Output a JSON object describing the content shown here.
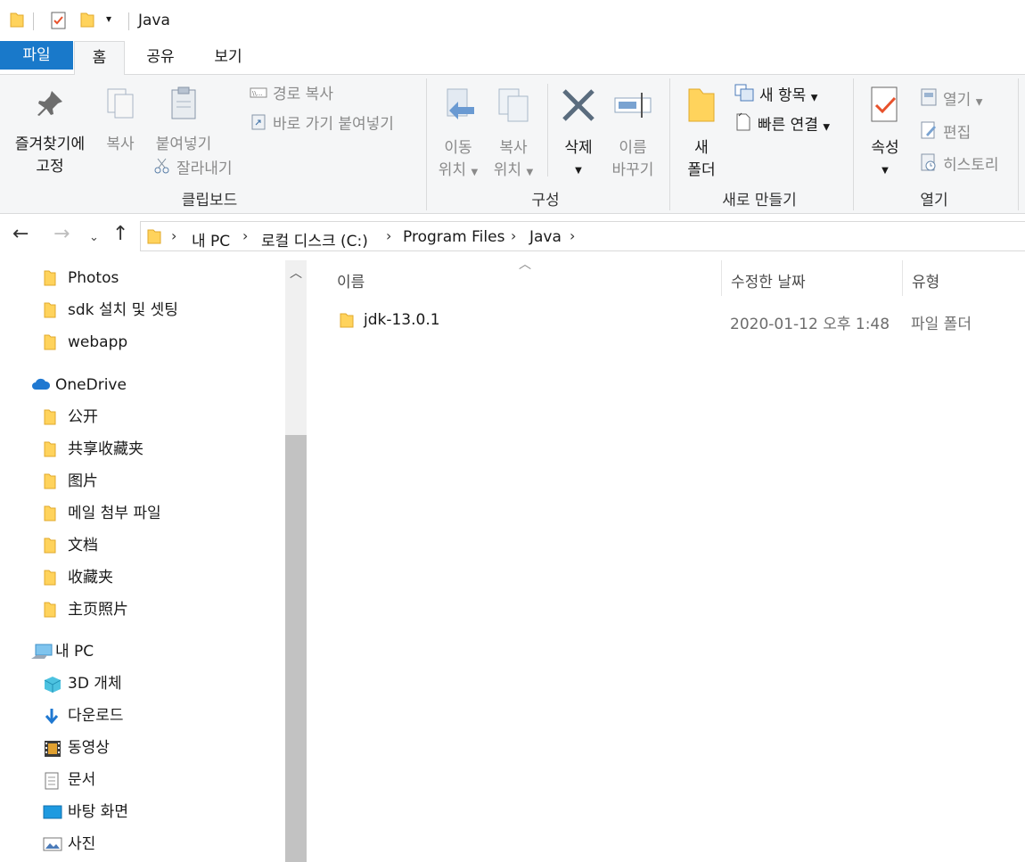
{
  "window": {
    "title": "Java"
  },
  "tabs": {
    "file": "파일",
    "home": "홈",
    "share": "공유",
    "view": "보기"
  },
  "ribbon": {
    "clipboard": {
      "label": "클립보드",
      "pin_line1": "즐겨찾기에",
      "pin_line2": "고정",
      "copy": "복사",
      "paste": "붙여넣기",
      "copy_path": "경로 복사",
      "paste_shortcut": "바로 가기 붙여넣기",
      "cut": "잘라내기"
    },
    "organize": {
      "label": "구성",
      "move_line1": "이동",
      "move_line2": "위치",
      "copyto_line1": "복사",
      "copyto_line2": "위치",
      "delete": "삭제",
      "rename_line1": "이름",
      "rename_line2": "바꾸기"
    },
    "new": {
      "label": "새로 만들기",
      "folder_line1": "새",
      "folder_line2": "폴더",
      "new_item": "새 항목",
      "easy_access": "빠른 연결"
    },
    "open": {
      "label": "열기",
      "properties": "속성",
      "open": "열기",
      "edit": "편집",
      "history": "히스토리"
    }
  },
  "address": {
    "crumbs": [
      "내 PC",
      "로컬 디스크 (C:)",
      "Program Files",
      "Java"
    ]
  },
  "navpane": {
    "items": [
      {
        "label": "Photos",
        "icon": "folder-icon"
      },
      {
        "label": "sdk 설치 및 셋팅",
        "icon": "folder-icon"
      },
      {
        "label": "webapp",
        "icon": "folder-icon"
      },
      {
        "label": "OneDrive",
        "icon": "cloud-icon"
      },
      {
        "label": "公开",
        "icon": "folder-icon"
      },
      {
        "label": "共享收藏夹",
        "icon": "folder-icon"
      },
      {
        "label": "图片",
        "icon": "folder-icon"
      },
      {
        "label": "메일 첨부 파일",
        "icon": "folder-icon"
      },
      {
        "label": "文档",
        "icon": "folder-icon"
      },
      {
        "label": "收藏夹",
        "icon": "folder-icon"
      },
      {
        "label": "主页照片",
        "icon": "folder-icon"
      },
      {
        "label": "내 PC",
        "icon": "computer-icon"
      },
      {
        "label": "3D 개체",
        "icon": "cube-icon"
      },
      {
        "label": "다운로드",
        "icon": "download-icon"
      },
      {
        "label": "동영상",
        "icon": "video-icon"
      },
      {
        "label": "문서",
        "icon": "document-icon"
      },
      {
        "label": "바탕 화면",
        "icon": "desktop-icon"
      },
      {
        "label": "사진",
        "icon": "picture-icon"
      }
    ]
  },
  "content": {
    "columns": {
      "name": "이름",
      "modified": "수정한 날짜",
      "type": "유형"
    },
    "rows": [
      {
        "name": "jdk-13.0.1",
        "modified": "2020-01-12 오후 1:48",
        "type": "파일 폴더"
      }
    ]
  },
  "colors": {
    "accent": "#1979ca",
    "folder": "#ffd35c",
    "ribbon_bg": "#f5f6f7"
  }
}
